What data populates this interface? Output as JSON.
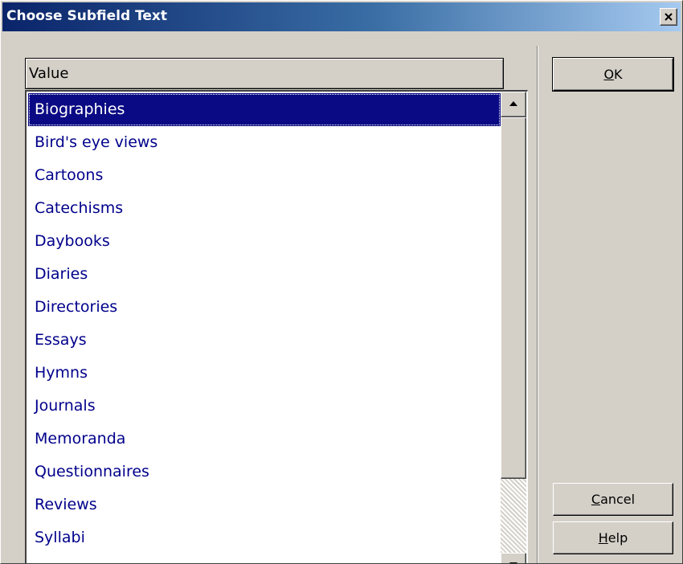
{
  "window": {
    "title": "Choose Subfield Text",
    "close_icon": "close-icon"
  },
  "list": {
    "column_header": "Value",
    "selected_index": 0,
    "items": [
      "Biographies",
      "Bird's eye views",
      "Cartoons",
      "Catechisms",
      "Daybooks",
      "Diaries",
      "Directories",
      "Essays",
      "Hymns",
      "Journals",
      "Memoranda",
      "Questionnaires",
      "Reviews",
      "Syllabi"
    ]
  },
  "buttons": {
    "ok": {
      "mnemonic": "O",
      "rest": "K"
    },
    "cancel": {
      "mnemonic": "C",
      "rest": "ancel"
    },
    "help": {
      "mnemonic": "H",
      "rest": "elp"
    }
  },
  "colors": {
    "titlebar_start": "#0a246a",
    "titlebar_end": "#a6caf0",
    "selection": "#0a0a84",
    "item_text": "#00008b",
    "face": "#d4d0c8"
  }
}
